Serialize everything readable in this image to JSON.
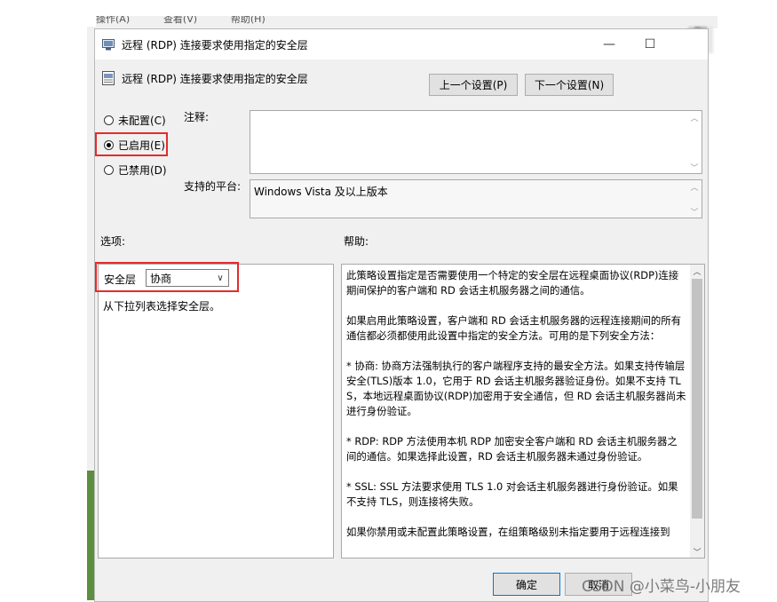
{
  "background": {
    "menu_items": [
      "操作(A)",
      "查看(V)",
      "帮助(H)"
    ]
  },
  "window": {
    "title": "远程 (RDP) 连接要求使用指定的安全层",
    "minimize_glyph": "—",
    "maximize_glyph": "☐"
  },
  "header": {
    "policy_title": "远程 (RDP) 连接要求使用指定的安全层",
    "prev_button": "上一个设置(P)",
    "next_button": "下一个设置(N)"
  },
  "state": {
    "options": [
      {
        "label": "未配置(C)",
        "selected": false
      },
      {
        "label": "已启用(E)",
        "selected": true
      },
      {
        "label": "已禁用(D)",
        "selected": false
      }
    ]
  },
  "comment": {
    "label": "注释:",
    "value": ""
  },
  "platform": {
    "label": "支持的平台:",
    "value": "Windows Vista 及以上版本"
  },
  "options_panel": {
    "heading": "选项:",
    "security_label": "安全层",
    "security_value": "协商",
    "hint": "从下拉列表选择安全层。"
  },
  "help_panel": {
    "heading": "帮助:",
    "paragraphs": [
      "此策略设置指定是否需要使用一个特定的安全层在远程桌面协议(RDP)连接期间保护的客户端和 RD 会话主机服务器之间的通信。",
      "如果启用此策略设置，客户端和 RD 会话主机服务器的远程连接期间的所有通信都必须都使用此设置中指定的安全方法。可用的是下列安全方法：",
      " * 协商: 协商方法强制执行的客户端程序支持的最安全方法。如果支持传输层安全(TLS)版本 1.0，它用于 RD 会话主机服务器验证身份。如果不支持 TLS，本地远程桌面协议(RDP)加密用于安全通信，但 RD 会话主机服务器尚未进行身份验证。",
      " * RDP: RDP 方法使用本机 RDP 加密安全客户端和 RD 会话主机服务器之间的通信。如果选择此设置，RD 会话主机服务器未通过身份验证。",
      " * SSL: SSL 方法要求使用 TLS 1.0 对会话主机服务器进行身份验证。如果不支持 TLS，则连接将失败。",
      "如果你禁用或未配置此策略设置，在组策略级别未指定要用于远程连接到"
    ]
  },
  "footer": {
    "ok_button": "确定",
    "cancel_button": "取消"
  },
  "watermark": "CSDN @小菜鸟-小朋友"
}
